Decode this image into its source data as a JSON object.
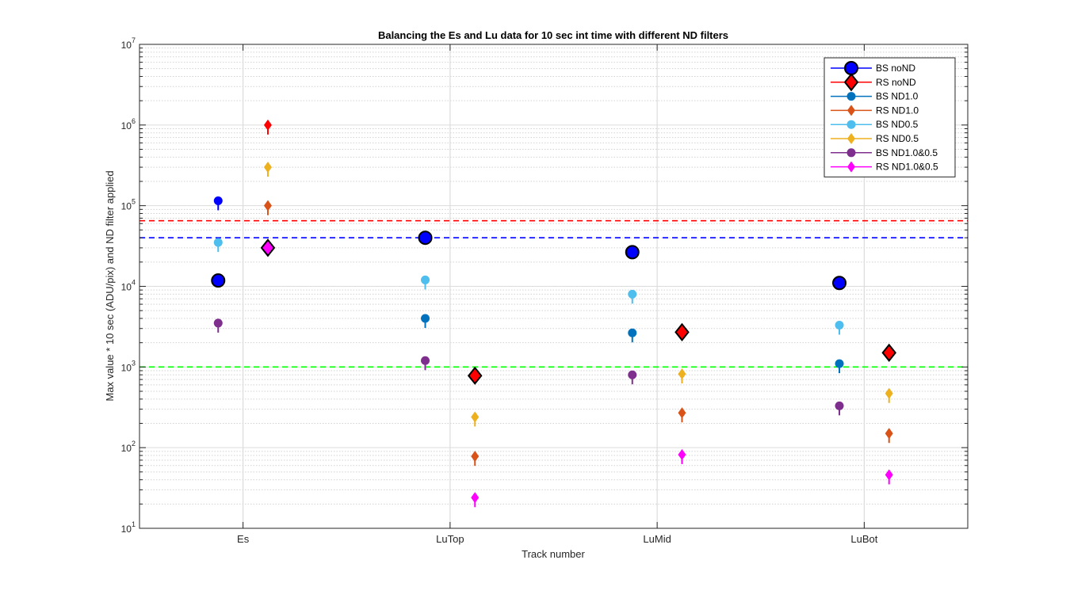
{
  "chart_data": {
    "type": "scatter",
    "title": "Balancing the Es and Lu data for 10  sec int time with different ND filters",
    "xlabel": "Track number",
    "ylabel": "Max value * 10 sec (ADU/pix) and ND filter applied",
    "yscale": "log",
    "ylim": [
      10,
      10000000
    ],
    "xlim": [
      0.5,
      4.5
    ],
    "grid": true,
    "legend_position": "top-right",
    "categories": [
      "Es",
      "LuTop",
      "LuMid",
      "LuBot"
    ],
    "xticks": [
      1,
      2,
      3,
      4
    ],
    "yticks": [
      {
        "value": 10,
        "base": "10",
        "exp": "1"
      },
      {
        "value": 100,
        "base": "10",
        "exp": "2"
      },
      {
        "value": 1000,
        "base": "10",
        "exp": "3"
      },
      {
        "value": 10000,
        "base": "10",
        "exp": "4"
      },
      {
        "value": 100000,
        "base": "10",
        "exp": "5"
      },
      {
        "value": 1000000,
        "base": "10",
        "exp": "6"
      },
      {
        "value": 10000000,
        "base": "10",
        "exp": "7"
      }
    ],
    "reference_lines": [
      {
        "y": 65000,
        "color": "#ff0000",
        "style": "dashed"
      },
      {
        "y": 40000,
        "color": "#0000ff",
        "style": "dashed"
      },
      {
        "y": 1000,
        "color": "#00ff00",
        "style": "dashed"
      }
    ],
    "series": [
      {
        "name": "BS noND",
        "color": "#0000ff",
        "marker": "circle",
        "size": "large",
        "points": [
          {
            "x": 0.88,
            "y": 11800
          },
          {
            "x": 1.88,
            "y": 40000
          },
          {
            "x": 2.88,
            "y": 26500
          },
          {
            "x": 3.88,
            "y": 11000
          }
        ]
      },
      {
        "name": "RS noND",
        "color": "#ff0000",
        "marker": "diamond",
        "size": "large",
        "points": [
          {
            "x": 2.12,
            "y": 780
          },
          {
            "x": 3.12,
            "y": 2700
          },
          {
            "x": 4.12,
            "y": 1500
          }
        ]
      },
      {
        "name": "BS ND1.0",
        "color": "#0072bd",
        "marker": "circle",
        "size": "small",
        "points": [
          {
            "x": 1.88,
            "y": 4000
          },
          {
            "x": 2.88,
            "y": 2650
          },
          {
            "x": 3.88,
            "y": 1100
          }
        ]
      },
      {
        "name": "RS ND1.0",
        "color": "#d95319",
        "marker": "diamond",
        "size": "small",
        "points": [
          {
            "x": 1.12,
            "y": 100000
          },
          {
            "x": 2.12,
            "y": 78
          },
          {
            "x": 3.12,
            "y": 270
          },
          {
            "x": 4.12,
            "y": 150
          }
        ]
      },
      {
        "name": "BS ND0.5",
        "color": "#4dbeee",
        "marker": "circle",
        "size": "small",
        "points": [
          {
            "x": 0.88,
            "y": 35000
          },
          {
            "x": 1.88,
            "y": 12000
          },
          {
            "x": 2.88,
            "y": 8000
          },
          {
            "x": 3.88,
            "y": 3300
          }
        ]
      },
      {
        "name": "RS ND0.5",
        "color": "#edb120",
        "marker": "diamond",
        "size": "small",
        "points": [
          {
            "x": 1.12,
            "y": 300000
          },
          {
            "x": 2.12,
            "y": 240
          },
          {
            "x": 3.12,
            "y": 820
          },
          {
            "x": 4.12,
            "y": 470
          }
        ]
      },
      {
        "name": "BS ND1.0&0.5",
        "color": "#7e2f8e",
        "marker": "circle",
        "size": "small",
        "points": [
          {
            "x": 0.88,
            "y": 3500
          },
          {
            "x": 1.88,
            "y": 1200
          },
          {
            "x": 2.88,
            "y": 800
          },
          {
            "x": 3.88,
            "y": 330
          }
        ]
      },
      {
        "name": "RS ND1.0&0.5",
        "color": "#ff00ff",
        "marker": "diamond",
        "size": "small",
        "points": [
          {
            "x": 2.12,
            "y": 24
          },
          {
            "x": 3.12,
            "y": 82
          },
          {
            "x": 4.12,
            "y": 46
          }
        ]
      }
    ],
    "highlight_points": [
      {
        "x": 0.88,
        "y": 115000,
        "color": "#0000ff",
        "marker": "circle",
        "size": "small"
      },
      {
        "x": 1.12,
        "y": 1000000,
        "color": "#ff0000",
        "marker": "diamond",
        "size": "small"
      },
      {
        "x": 1.12,
        "y": 30000,
        "color": "#ff00ff",
        "marker": "diamond",
        "size": "large"
      }
    ]
  }
}
